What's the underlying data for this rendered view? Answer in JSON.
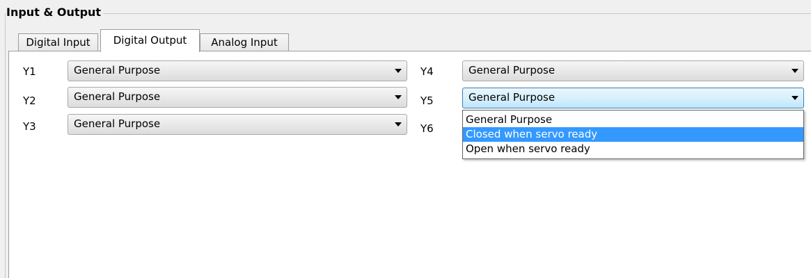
{
  "group": {
    "title": "Input & Output"
  },
  "tabs": [
    {
      "label": "Digital Input",
      "active": false
    },
    {
      "label": "Digital Output",
      "active": true
    },
    {
      "label": "Analog Input",
      "active": false
    }
  ],
  "outputs": {
    "y1": {
      "label": "Y1",
      "value": "General Purpose"
    },
    "y2": {
      "label": "Y2",
      "value": "General Purpose"
    },
    "y3": {
      "label": "Y3",
      "value": "General Purpose"
    },
    "y4": {
      "label": "Y4",
      "value": "General Purpose"
    },
    "y5": {
      "label": "Y5",
      "value": "General Purpose"
    },
    "y6": {
      "label": "Y6"
    }
  },
  "dropdown": {
    "options": [
      "General Purpose",
      "Closed when servo ready",
      "Open when servo ready"
    ],
    "highlighted": "Closed when servo ready"
  },
  "colors": {
    "selection": "#3399ff",
    "focus_border": "#3c7fb1"
  }
}
